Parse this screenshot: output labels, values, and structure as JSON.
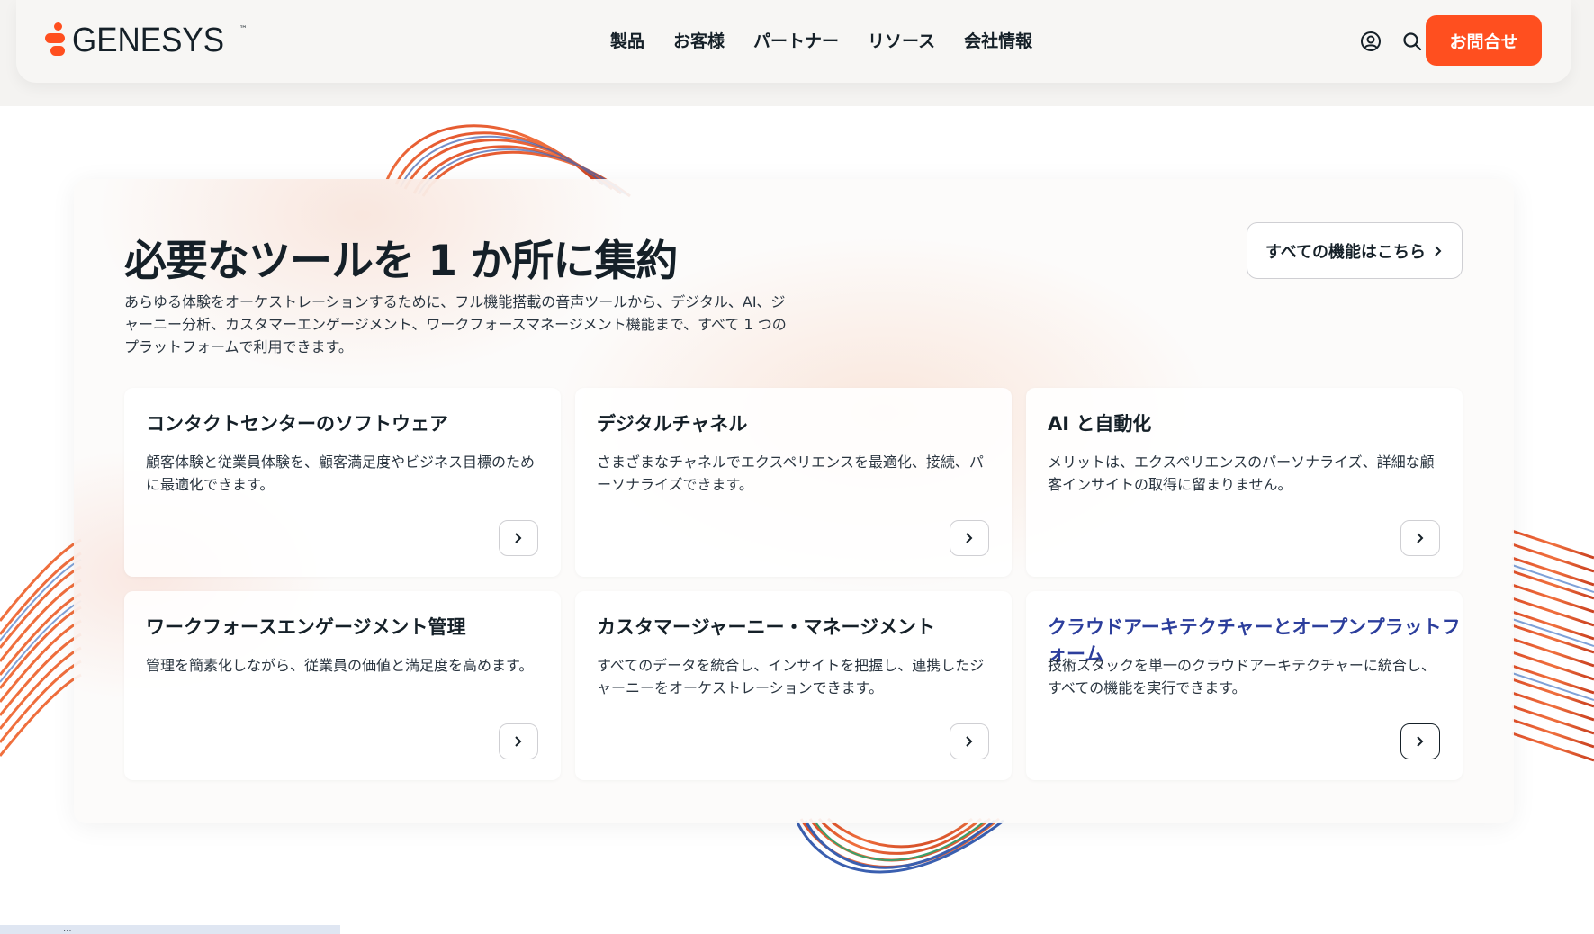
{
  "brand": {
    "name": "GENESYS",
    "tm": "™",
    "accent": "#ff4f1f"
  },
  "nav": {
    "links": [
      "製品",
      "お客様",
      "パートナー",
      "リソース",
      "会社情報"
    ],
    "icons": [
      "account-icon",
      "search-icon"
    ],
    "contact_label": "お問合せ"
  },
  "main": {
    "title": "必要なツールを 1 か所に集約",
    "description": "あらゆる体験をオーケストレーションするために、フル機能搭載の音声ツールから、デジタル、AI、ジャーニー分析、カスタマーエンゲージメント、ワークフォースマネージメント機能まで、すべて 1 つのプラットフォームで利用できます。",
    "all_features_label": "すべての機能はこちら",
    "cards": [
      {
        "title": "コンタクトセンターのソフトウェア",
        "desc": "顧客体験と従業員体験を、顧客満足度やビジネス目標のために最適化できます。"
      },
      {
        "title": "デジタルチャネル",
        "desc": "さまざまなチャネルでエクスペリエンスを最適化、接続、パーソナライズできます。"
      },
      {
        "title": "AI と自動化",
        "desc": "メリットは、エクスペリエンスのパーソナライズ、詳細な顧客インサイトの取得に留まりません。"
      },
      {
        "title": "ワークフォースエンゲージメント管理",
        "desc": "管理を簡素化しながら、従業員の価値と満足度を高めます。"
      },
      {
        "title": "カスタマージャーニー・マネージメント",
        "desc": "すべてのデータを統合し、インサイトを把握し、連携したジャーニーをオーケストレーションできます。"
      },
      {
        "title": "クラウドアーキテクチャーとオープンプラットフォーム",
        "desc": "技術スタックを単一のクラウドアーキテクチャーに統合し、すべての機能を実行できます。"
      }
    ]
  },
  "status_url": "..."
}
